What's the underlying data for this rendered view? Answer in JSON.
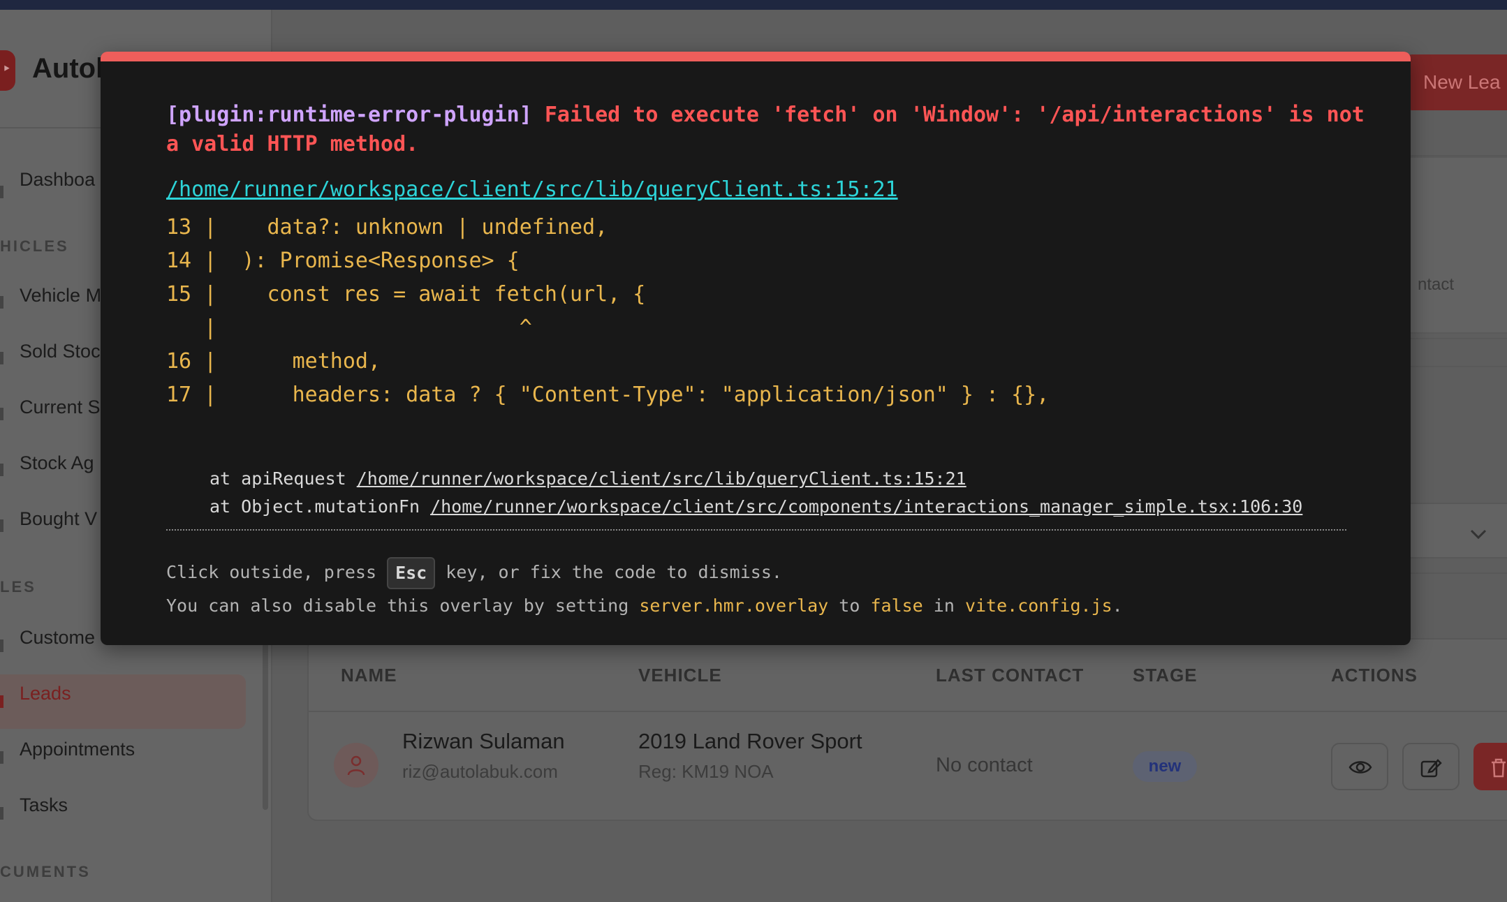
{
  "sidebar": {
    "app_name": "Autola",
    "items": {
      "dashboard": "Dashboa",
      "vehicles_section": "HICLES",
      "vehicle_m": "Vehicle M",
      "sold_stock": "Sold Stoc",
      "current_s": "Current S",
      "stock_ag": "Stock Ag",
      "bought_v": "Bought V",
      "sales_section": "LES",
      "customers": "Custome",
      "leads": "Leads",
      "appointments": "Appointments",
      "tasks": "Tasks",
      "documents_section": "CUMENTS"
    }
  },
  "main": {
    "new_lead_label": "New Lea",
    "contact_partial": "ntact"
  },
  "table": {
    "headers": [
      "NAME",
      "VEHICLE",
      "LAST CONTACT",
      "STAGE",
      "ACTIONS"
    ],
    "rows": [
      {
        "name": "Rizwan Sulaman",
        "email": "riz@autolabuk.com",
        "vehicle": "2019 Land Rover Sport",
        "reg": "Reg: KM19 NOA",
        "last_contact": "No contact",
        "stage": "new"
      }
    ]
  },
  "overlay": {
    "plugin": "[plugin:runtime-error-plugin]",
    "message": "Failed to execute 'fetch' on 'Window': '/api/interactions' is not a valid HTTP method.",
    "file": "/home/runner/workspace/client/src/lib/queryClient.ts:15:21",
    "frame": "13 |    data?: unknown | undefined,\n14 |  ): Promise<Response> {\n15 |    const res = await fetch(url, {\n   |                        ^\n16 |      method,\n17 |      headers: data ? { \"Content-Type\": \"application/json\" } : {},",
    "stack": [
      {
        "prefix": "at apiRequest ",
        "link": "/home/runner/workspace/client/src/lib/queryClient.ts:15:21"
      },
      {
        "prefix": "at Object.mutationFn ",
        "link": "/home/runner/workspace/client/src/components/interactions_manager_simple.tsx:106:30"
      }
    ],
    "tip1_before": "Click outside, press ",
    "tip1_key": "Esc",
    "tip1_after": " key, or fix the code to dismiss.",
    "tip2_before": "You can also disable this overlay by setting ",
    "tip2_setting": "server.hmr.overlay",
    "tip2_mid1": " to ",
    "tip2_value": "false",
    "tip2_mid2": " in ",
    "tip2_file": "vite.config.js",
    "tip2_end": "."
  }
}
